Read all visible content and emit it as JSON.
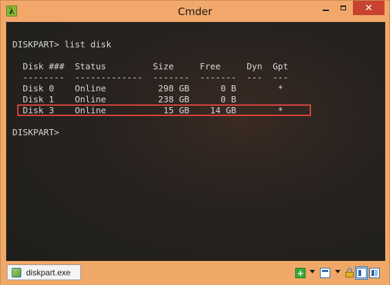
{
  "window": {
    "title": "Cmder",
    "app_icon_glyph": "λ",
    "minimize_icon": "minimize-icon",
    "maximize_icon": "maximize-icon",
    "close_glyph": "✕"
  },
  "console": {
    "lines": [
      "DISKPART> list disk",
      "",
      "  Disk ###  Status         Size     Free     Dyn  Gpt",
      "  --------  -------------  -------  -------  ---  ---",
      "  Disk 0    Online          298 GB      0 B        *",
      "  Disk 1    Online          238 GB      0 B",
      "  Disk 3    Online           15 GB    14 GB        *",
      "",
      "DISKPART>"
    ],
    "highlight_color": "#d8453c"
  },
  "statusbar": {
    "tab_label": "diskpart.exe",
    "new_console_glyph": "+"
  }
}
